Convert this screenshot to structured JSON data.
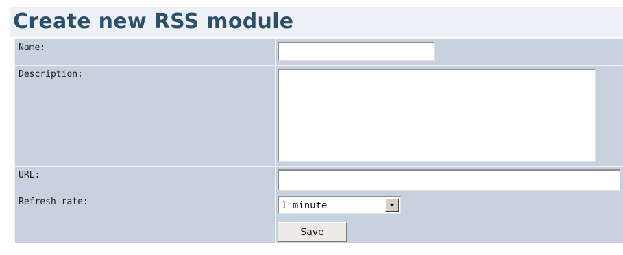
{
  "page": {
    "title": "Create new RSS module"
  },
  "form": {
    "name": {
      "label": "Name:",
      "value": ""
    },
    "description": {
      "label": "Description:",
      "value": ""
    },
    "url": {
      "label": "URL:",
      "value": ""
    },
    "refresh_rate": {
      "label": "Refresh rate:",
      "selected": "1 minute"
    },
    "save_label": "Save"
  },
  "colors": {
    "title": "#2c4f6b",
    "heading_bg": "#edf0f4",
    "cell_bg": "#c8d2de"
  },
  "icons": {
    "dropdown": "chevron-down-icon"
  }
}
